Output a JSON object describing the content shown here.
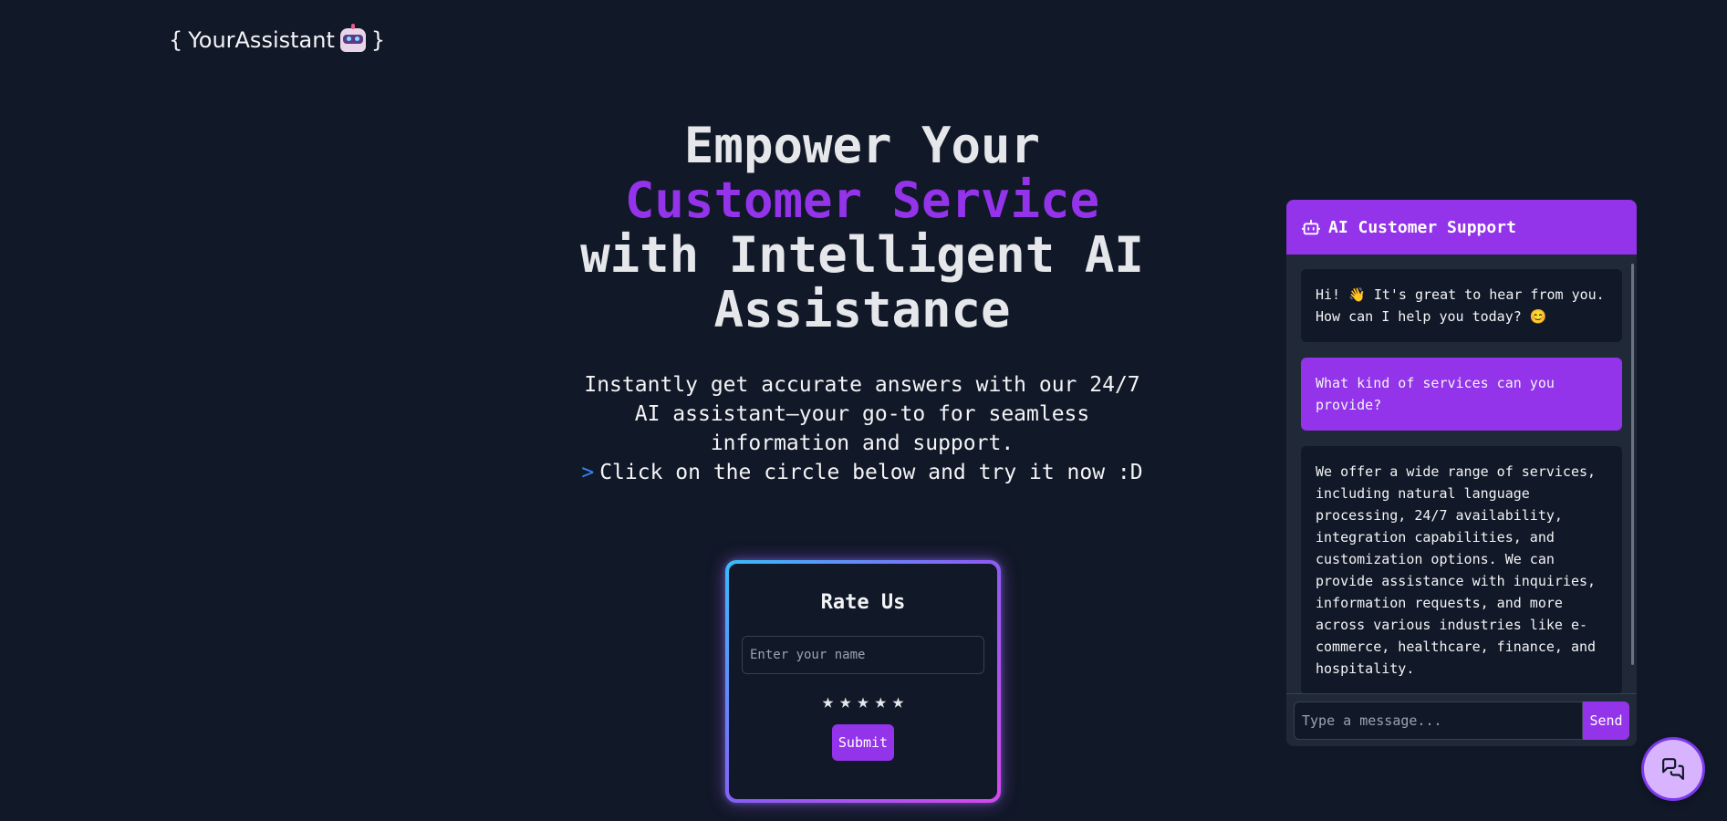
{
  "brand": {
    "open": "{",
    "name": "YourAssistant",
    "close": "}",
    "icon": "robot-icon"
  },
  "hero": {
    "line1": "Empower Your",
    "accent": "Customer Service",
    "line3": "with Intelligent AI",
    "line4": "Assistance",
    "description": "Instantly get accurate answers with our 24/7 AI assistant—your go-to for seamless information and support.",
    "cta_prefix": ">",
    "cta": "Click on the circle below and try it now :D"
  },
  "rating": {
    "title": "Rate Us",
    "name_placeholder": "Enter your name",
    "stars": [
      "★",
      "★",
      "★",
      "★",
      "★"
    ],
    "submit_label": "Submit"
  },
  "chat": {
    "title": "AI Customer Support",
    "messages": [
      {
        "role": "bot",
        "text": "Hi! 👋 It's great to hear from you. How can I help you today? 😊"
      },
      {
        "role": "user",
        "text": "What kind of services can you provide?"
      },
      {
        "role": "bot",
        "text": "We offer a wide range of services, including natural language processing, 24/7 availability, integration capabilities, and customization options. We can provide assistance with inquiries, information requests, and more across various industries like e-commerce, healthcare, finance, and hospitality."
      }
    ],
    "input_placeholder": "Type a message...",
    "send_label": "Send"
  },
  "fab": {
    "icon": "chat-bubbles-icon"
  },
  "colors": {
    "background": "#111827",
    "accent": "#9333ea",
    "panel": "#1f2937",
    "link": "#3b82f6"
  }
}
